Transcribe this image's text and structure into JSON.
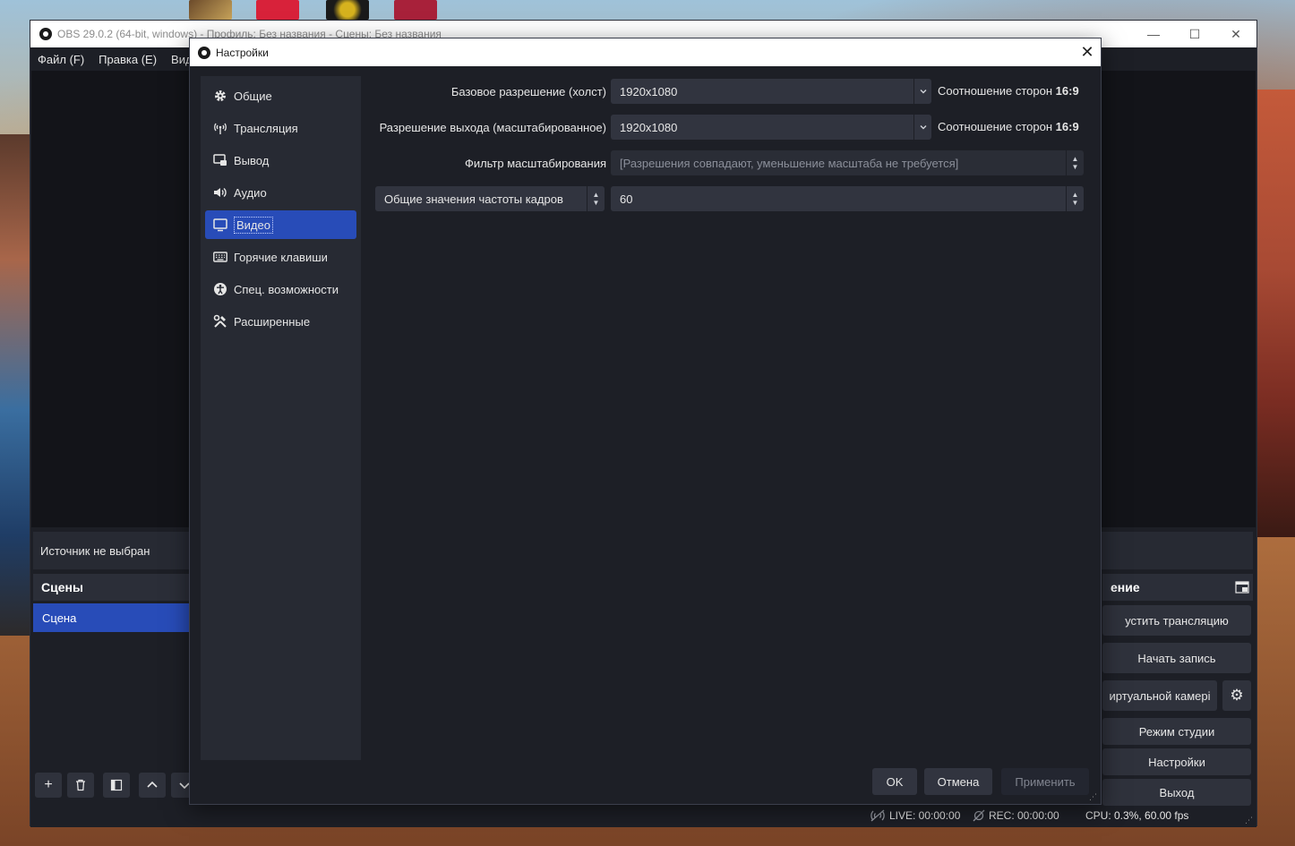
{
  "obs_main": {
    "title": "OBS 29.0.2 (64-bit, windows) - Профиль: Без названия - Сцены: Без названия",
    "menu": [
      "Файл (F)",
      "Правка (E)",
      "Вид"
    ],
    "source_status": "Источник не выбран",
    "scenes_header": "Сцены",
    "scenes": [
      "Сцена"
    ],
    "controls_header": "ение",
    "controls": {
      "stream": "устить трансляцию",
      "record": "Начать запись",
      "virtual_cam": "иртуальной камері",
      "studio_mode": "Режим студии",
      "settings": "Настройки",
      "exit": "Выход"
    },
    "status": {
      "live": "LIVE: 00:00:00",
      "rec": "REC: 00:00:00",
      "cpu": "CPU: 0.3%, 60.00 fps"
    }
  },
  "dialog": {
    "title": "Настройки",
    "nav": [
      {
        "label": "Общие",
        "icon": "gear-icon"
      },
      {
        "label": "Трансляция",
        "icon": "antenna-icon"
      },
      {
        "label": "Вывод",
        "icon": "output-icon"
      },
      {
        "label": "Аудио",
        "icon": "speaker-icon"
      },
      {
        "label": "Видео",
        "icon": "monitor-icon",
        "active": true
      },
      {
        "label": "Горячие клавиши",
        "icon": "keyboard-icon"
      },
      {
        "label": "Спец. возможности",
        "icon": "accessibility-icon"
      },
      {
        "label": "Расширенные",
        "icon": "tools-icon"
      }
    ],
    "video": {
      "base_label": "Базовое разрешение (холст)",
      "base_value": "1920x1080",
      "base_aspect_prefix": "Соотношение сторон",
      "base_aspect": "16:9",
      "output_label": "Разрешение выхода (масштабированное)",
      "output_value": "1920x1080",
      "output_aspect_prefix": "Соотношение сторон",
      "output_aspect": "16:9",
      "filter_label": "Фильтр масштабирования",
      "filter_value": "[Разрешения совпадают, уменьшение масштаба не требуется]",
      "fps_type": "Общие значения частоты кадров",
      "fps_value": "60"
    },
    "buttons": {
      "ok": "OK",
      "cancel": "Отмена",
      "apply": "Применить"
    }
  },
  "colors": {
    "accent": "#284cb8",
    "bg": "#1d1f26",
    "panel": "#272a33"
  }
}
